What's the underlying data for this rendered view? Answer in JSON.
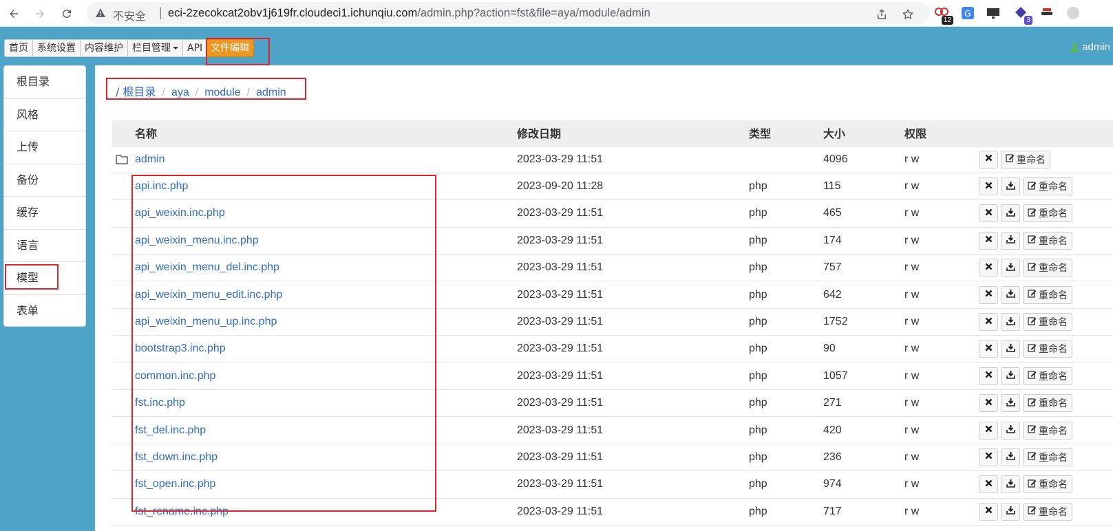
{
  "browser": {
    "insecure_label": "不安全",
    "url_host": "eci-2zecokcat2obv1j619fr.cloudeci1.ichunqiu.com",
    "url_rest": "/admin.php?action=fst&file=aya/module/admin",
    "ext_badges": [
      "12",
      "3"
    ]
  },
  "topnav": {
    "items": [
      "首页",
      "系统设置",
      "内容维护",
      "栏目管理",
      "API",
      "文件编辑"
    ],
    "user": "admin"
  },
  "sidebar": {
    "items": [
      "根目录",
      "风格",
      "上传",
      "备份",
      "缓存",
      "语言",
      "模型",
      "表单"
    ]
  },
  "breadcrumb": {
    "root": "/ 根目录",
    "parts": [
      "aya",
      "module",
      "admin"
    ]
  },
  "table": {
    "headers": [
      "名称",
      "修改日期",
      "类型",
      "大小",
      "权限"
    ],
    "delete_icon": "times-icon",
    "download_icon": "download-icon",
    "rename_label": "重命名",
    "rows": [
      {
        "name": "admin",
        "date": "2023-03-29 11:51",
        "type": "",
        "size": "4096",
        "perm": "r w",
        "folder": true
      },
      {
        "name": "api.inc.php",
        "date": "2023-09-20 11:28",
        "type": "php",
        "size": "115",
        "perm": "r w"
      },
      {
        "name": "api_weixin.inc.php",
        "date": "2023-03-29 11:51",
        "type": "php",
        "size": "465",
        "perm": "r w"
      },
      {
        "name": "api_weixin_menu.inc.php",
        "date": "2023-03-29 11:51",
        "type": "php",
        "size": "174",
        "perm": "r w"
      },
      {
        "name": "api_weixin_menu_del.inc.php",
        "date": "2023-03-29 11:51",
        "type": "php",
        "size": "757",
        "perm": "r w"
      },
      {
        "name": "api_weixin_menu_edit.inc.php",
        "date": "2023-03-29 11:51",
        "type": "php",
        "size": "642",
        "perm": "r w"
      },
      {
        "name": "api_weixin_menu_up.inc.php",
        "date": "2023-03-29 11:51",
        "type": "php",
        "size": "1752",
        "perm": "r w"
      },
      {
        "name": "bootstrap3.inc.php",
        "date": "2023-03-29 11:51",
        "type": "php",
        "size": "90",
        "perm": "r w"
      },
      {
        "name": "common.inc.php",
        "date": "2023-03-29 11:51",
        "type": "php",
        "size": "1057",
        "perm": "r w"
      },
      {
        "name": "fst.inc.php",
        "date": "2023-03-29 11:51",
        "type": "php",
        "size": "271",
        "perm": "r w"
      },
      {
        "name": "fst_del.inc.php",
        "date": "2023-03-29 11:51",
        "type": "php",
        "size": "420",
        "perm": "r w"
      },
      {
        "name": "fst_down.inc.php",
        "date": "2023-03-29 11:51",
        "type": "php",
        "size": "236",
        "perm": "r w"
      },
      {
        "name": "fst_open.inc.php",
        "date": "2023-03-29 11:51",
        "type": "php",
        "size": "974",
        "perm": "r w"
      },
      {
        "name": "fst_rename.inc.php",
        "date": "2023-03-29 11:51",
        "type": "php",
        "size": "717",
        "perm": "r w"
      }
    ]
  },
  "colors": {
    "page_bg": "#4da3c8",
    "accent_active": "#ec971f",
    "link": "#2e6cc3",
    "highlight_box": "#e0242f"
  }
}
